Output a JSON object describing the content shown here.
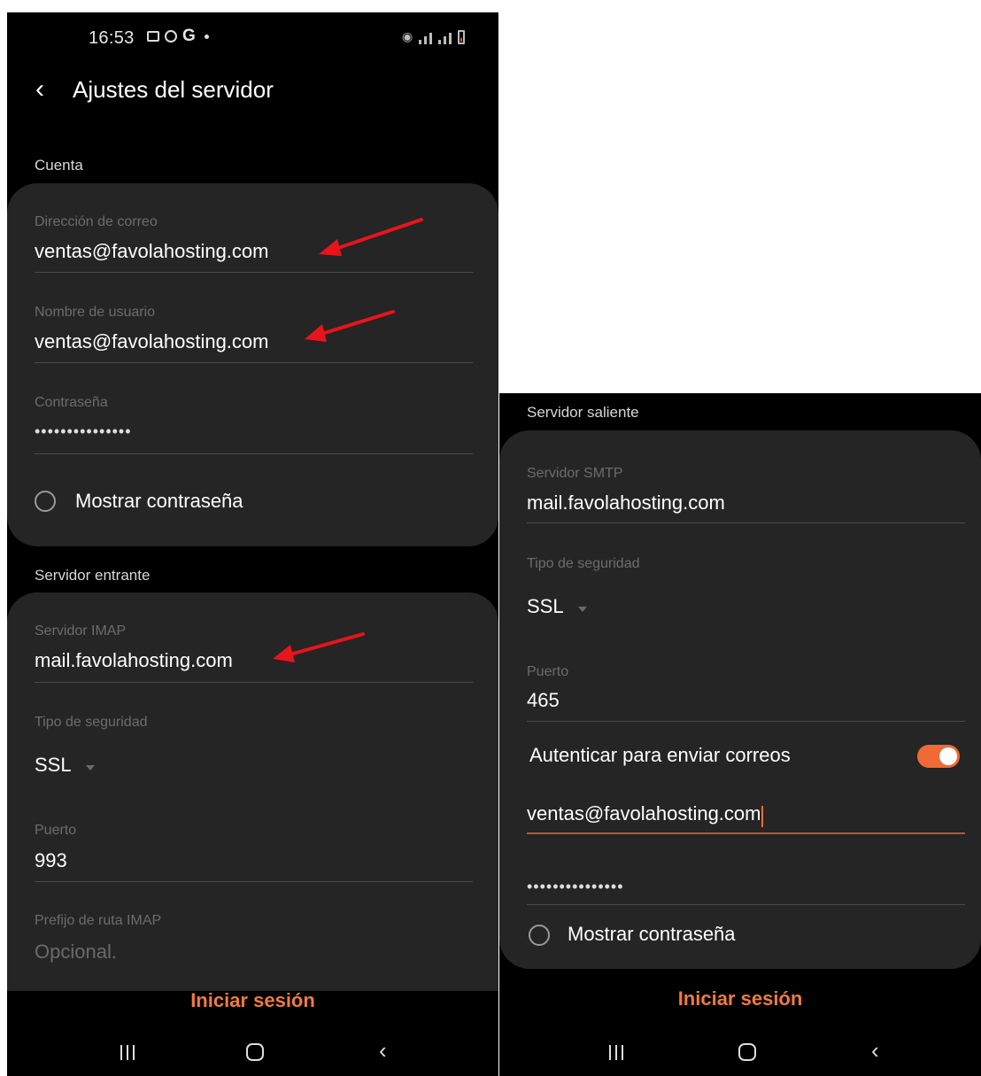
{
  "left_screen": {
    "status_bar": {
      "time": "16:53"
    },
    "header": {
      "title": "Ajustes del servidor"
    },
    "account_section": {
      "heading": "Cuenta",
      "email_label": "Dirección de correo",
      "email_value": "ventas@favolahosting.com",
      "username_label": "Nombre de usuario",
      "username_value": "ventas@favolahosting.com",
      "password_label": "Contraseña",
      "password_value": "•••••••••••••••",
      "show_password_label": "Mostrar contraseña"
    },
    "incoming_section": {
      "heading": "Servidor entrante",
      "imap_label": "Servidor IMAP",
      "imap_value": "mail.favolahosting.com",
      "security_label": "Tipo de seguridad",
      "security_value": "SSL",
      "port_label": "Puerto",
      "port_value": "993",
      "prefix_label": "Prefijo de ruta IMAP",
      "prefix_placeholder": "Opcional."
    },
    "login_button": "Iniciar sesión"
  },
  "right_screen": {
    "outgoing_section": {
      "heading": "Servidor saliente",
      "smtp_label": "Servidor SMTP",
      "smtp_value": "mail.favolahosting.com",
      "security_label": "Tipo de seguridad",
      "security_value": "SSL",
      "port_label": "Puerto",
      "port_value": "465",
      "auth_label": "Autenticar para enviar correos",
      "auth_enabled": true,
      "auth_user_value": "ventas@favolahosting.com",
      "auth_password_value": "•••••••••••••••",
      "show_password_label": "Mostrar contraseña"
    },
    "login_button": "Iniciar sesión"
  },
  "colors": {
    "accent": "#f07b3f",
    "toggle_on": "#f06a35",
    "annotation_arrow": "#e8141b",
    "card_bg": "#252525",
    "screen_bg": "#000000"
  }
}
